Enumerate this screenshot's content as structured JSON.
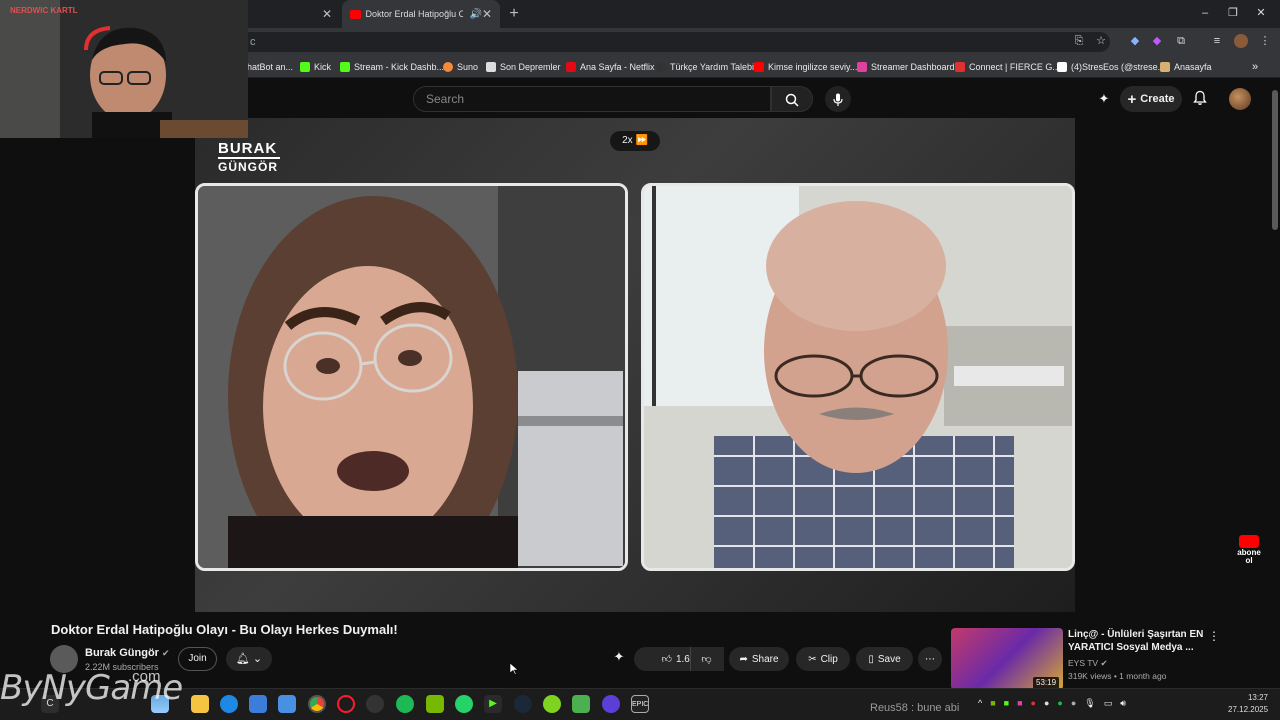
{
  "browser": {
    "tabs": [
      {
        "label": ""
      },
      {
        "label": "Doktor Erdal Hatipoğlu Olay"
      }
    ],
    "bookmarks": [
      {
        "label": "hatBot an...",
        "color": "#6b8cff"
      },
      {
        "label": "Kick",
        "color": "#53fc18"
      },
      {
        "label": "Stream - Kick Dashb...",
        "color": "#53fc18"
      },
      {
        "label": "Suno",
        "color": "#f58a3a"
      },
      {
        "label": "Son Depremler",
        "color": "#dddddd"
      },
      {
        "label": "Ana Sayfa - Netflix",
        "color": "#e50914"
      },
      {
        "label": "Türkçe Yardım Talebi",
        "color": "#222222"
      },
      {
        "label": "Kimse ingilizce seviy...",
        "color": "#ff0000"
      },
      {
        "label": "Streamer Dashboard",
        "color": "#e040a0"
      },
      {
        "label": "Connect | FIERCE G...",
        "color": "#e03030"
      },
      {
        "label": "(4)StresEos (@strese...",
        "color": "#ffffff"
      },
      {
        "label": "Anasayfa",
        "color": "#d8b070"
      }
    ]
  },
  "youtube": {
    "search_placeholder": "Search",
    "create_label": "Create",
    "video": {
      "speed_label": "2x",
      "logo_line1": "BURAK",
      "logo_line2": "GÜNGÖR",
      "abone_label": "abone ol",
      "title": "Doktor Erdal Hatipoğlu Olayı - Bu Olayı Herkes Duymalı!",
      "channel": "Burak Güngör",
      "subscribers": "2.22M subscribers",
      "join_label": "Join",
      "likes": "1.6K",
      "share_label": "Share",
      "clip_label": "Clip",
      "save_label": "Save"
    },
    "recommended": {
      "title": "Linç@ - Ünlüleri Şaşırtan EN YARATICI Sosyal Medya ...",
      "channel": "EYS TV",
      "views": "319K views",
      "age": "1 month ago",
      "duration": "53:19"
    }
  },
  "overlay": {
    "webcam_name": "NERDWIC KARTL",
    "watermark": "ByNyGame",
    "watermark_suffix": ".com",
    "chat_message": "Reus58 : bune abi"
  },
  "taskbar": {
    "time": "13:27",
    "date": "27.12.2025"
  },
  "colors": {
    "background": "#0f0f0f",
    "accent": "#ff0000",
    "button": "#272727"
  }
}
